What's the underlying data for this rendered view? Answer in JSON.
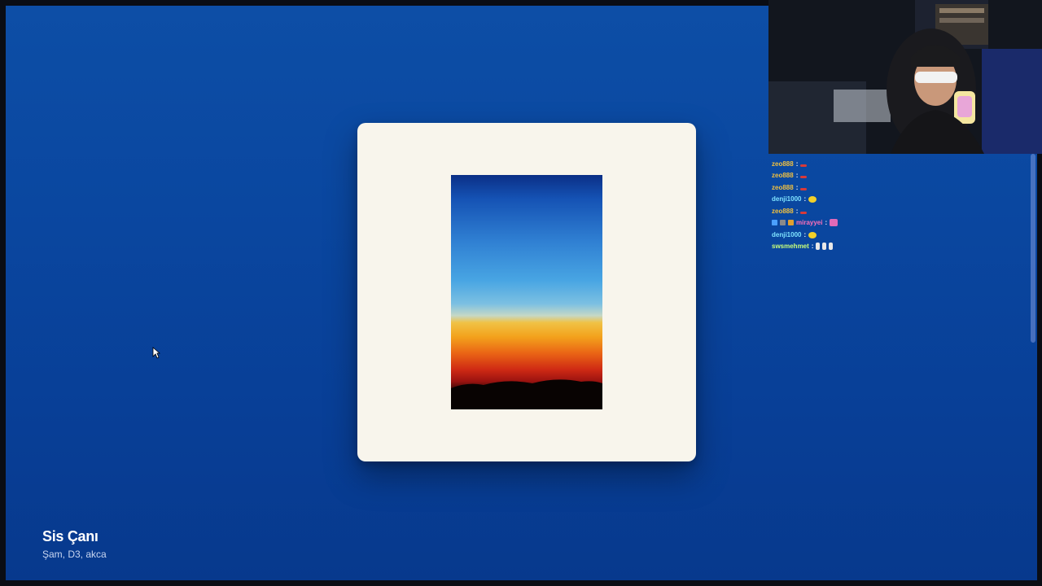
{
  "now_playing": {
    "title": "Sis Çanı",
    "artists": "Şam, D3, akca"
  },
  "chat": {
    "messages": [
      {
        "user": "zeo888",
        "sep": ":",
        "emote": "red-emote"
      },
      {
        "user": "zeo888",
        "sep": ":",
        "emote": "red-emote"
      },
      {
        "user": "zeo888",
        "sep": ":",
        "emote": "red-emote"
      },
      {
        "user": "denji1000",
        "sep": ":",
        "emote": "yellow-emote"
      },
      {
        "user": "zeo888",
        "sep": ":",
        "emote": "red-emote"
      },
      {
        "user": "mirayyei",
        "sep": ":",
        "emote": "pink-emote"
      },
      {
        "user": "denji1000",
        "sep": ":",
        "emote": "yellow-emote"
      },
      {
        "user": "swsmehmet",
        "sep": ":",
        "emote": "white-emote"
      }
    ]
  },
  "colors": {
    "stage_top": "#0d4ea6",
    "stage_bottom": "#07398d",
    "card": "#f8f5ec"
  }
}
